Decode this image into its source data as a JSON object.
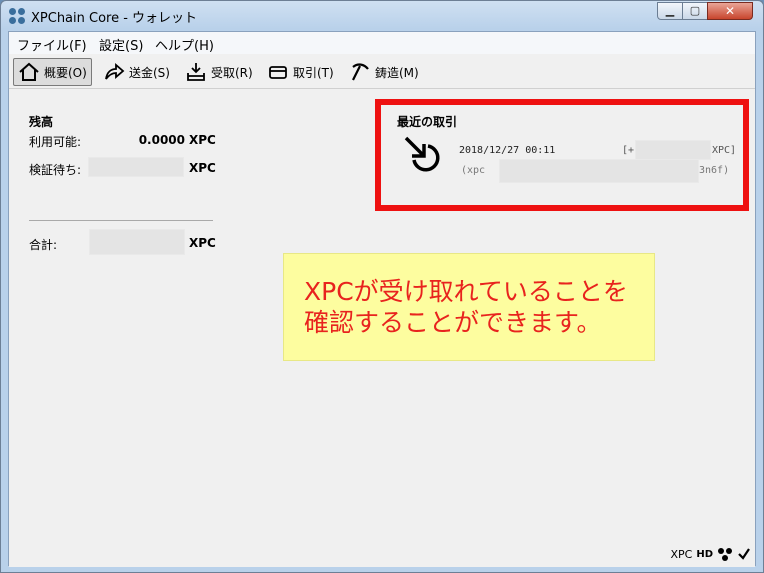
{
  "window": {
    "title": "XPChain Core - ウォレット"
  },
  "menu": [
    "ファイル(F)",
    "設定(S)",
    "ヘルプ(H)"
  ],
  "toolbar": [
    {
      "label": "概要(O)",
      "icon": "home-icon"
    },
    {
      "label": "送金(S)",
      "icon": "send-arrow-icon"
    },
    {
      "label": "受取(R)",
      "icon": "receive-tray-icon"
    },
    {
      "label": "取引(T)",
      "icon": "card-icon"
    },
    {
      "label": "鋳造(M)",
      "icon": "pickaxe-icon"
    }
  ],
  "balance": {
    "title": "残高",
    "available_label": "利用可能:",
    "available_value": "0.0000",
    "pending_label": "検証待ち:",
    "total_label": "合計:",
    "unit": "XPC"
  },
  "recent": {
    "title": "最近の取引",
    "tx": {
      "date": "2018/12/27 00:11",
      "amount_prefix": "[+",
      "amount_suffix": "XPC]",
      "address_prefix": "(xpc",
      "address_suffix": "3n6f)"
    }
  },
  "annotation": {
    "text": "XPCが受け取れていることを確認することができます。"
  },
  "status": {
    "unit": "XPC",
    "hd": "HD"
  },
  "colors": {
    "highlight_border": "#ee1111",
    "callout_bg": "#fdfd9f",
    "callout_text": "#e8231e"
  }
}
